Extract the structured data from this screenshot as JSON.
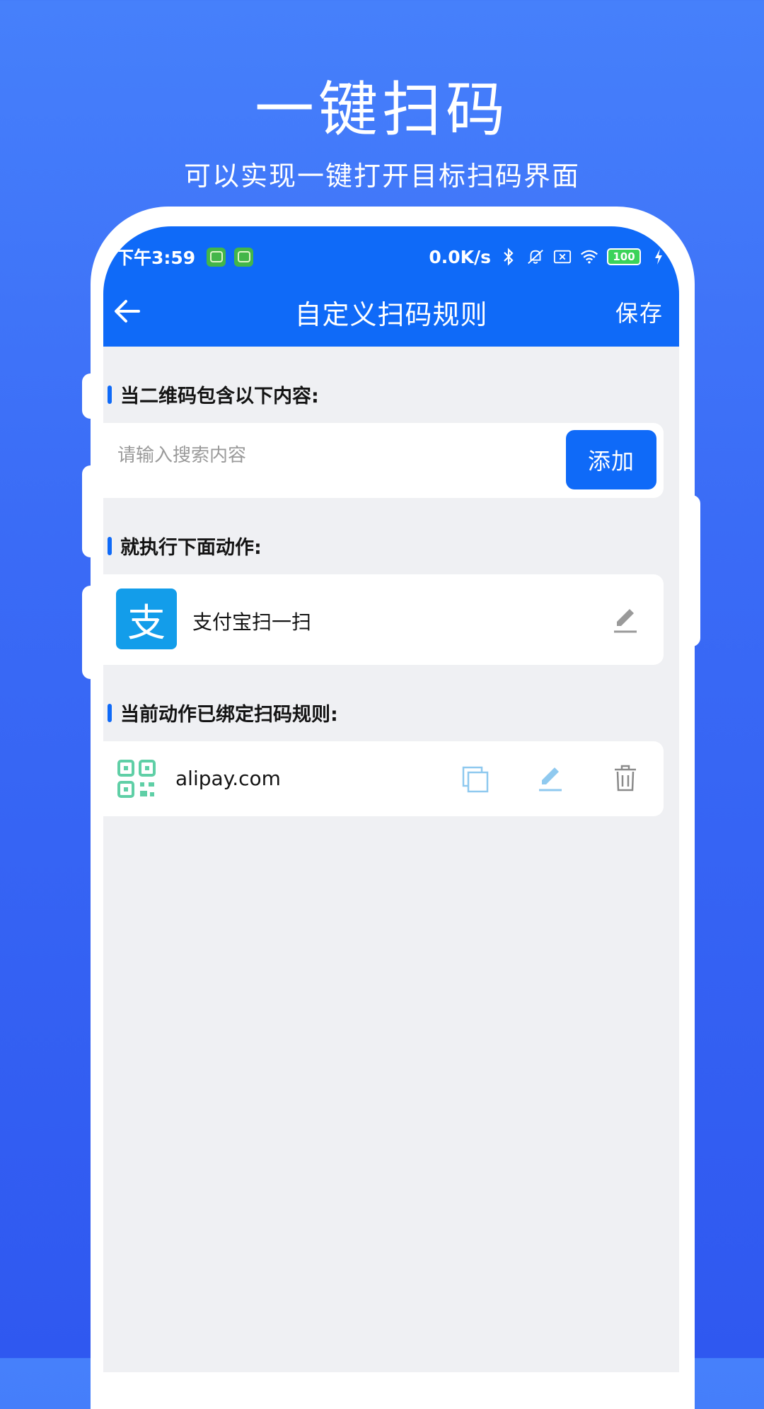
{
  "hero": {
    "title": "一键扫码",
    "subtitle": "可以实现一键打开目标扫码界面"
  },
  "statusbar": {
    "time": "下午3:59",
    "network_speed": "0.0K/s",
    "battery": "100",
    "icons": [
      "bluetooth-icon",
      "mute-bell-icon",
      "no-sim-icon",
      "wifi-icon",
      "battery-icon",
      "charging-icon"
    ]
  },
  "appbar": {
    "title": "自定义扫码规则",
    "save_label": "保存"
  },
  "condition_section": {
    "title": "当二维码包含以下内容:",
    "search_placeholder": "请输入搜索内容",
    "search_value": "",
    "add_label": "添加"
  },
  "action_section": {
    "title": "就执行下面动作:",
    "action_label": "支付宝扫一扫",
    "logo_glyph": "支"
  },
  "rules_section": {
    "title": "当前动作已绑定扫码规则:",
    "rules": [
      {
        "text": "alipay.com"
      }
    ]
  },
  "colors": {
    "primary": "#0f6af8",
    "background_top": "#4680fb",
    "background_bottom": "#2f58f0",
    "alipay": "#139dea",
    "qr_green": "#5fcfa6",
    "light_blue_icon": "#8fc9ef"
  }
}
